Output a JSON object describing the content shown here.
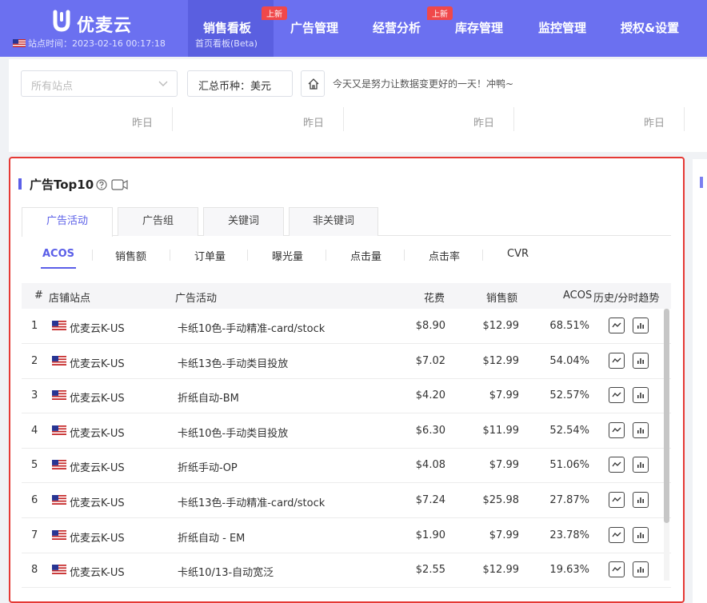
{
  "brand": {
    "name": "优麦云",
    "site_time": "站点时间：2023-02-16 00:17:18"
  },
  "nav": {
    "items": [
      {
        "label": "销售看板",
        "sub": "首页看板(Beta)",
        "badge": "上新",
        "active": true
      },
      {
        "label": "广告管理"
      },
      {
        "label": "经营分析",
        "badge": "上新"
      },
      {
        "label": "库存管理"
      },
      {
        "label": "监控管理"
      },
      {
        "label": "授权&设置"
      }
    ]
  },
  "filter": {
    "site_placeholder": "所有站点",
    "currency_label": "汇总币种：美元",
    "motto": "今天又是努力让数据变更好的一天！冲鸭~",
    "yesterday_label": "昨日"
  },
  "card": {
    "title": "广告Top10",
    "tabs": [
      "广告活动",
      "广告组",
      "关键词",
      "非关键词"
    ],
    "metrics": [
      "ACOS",
      "销售额",
      "订单量",
      "曝光量",
      "点击量",
      "点击率",
      "CVR"
    ]
  },
  "table": {
    "headers": {
      "index": "#",
      "store": "店铺站点",
      "campaign": "广告活动",
      "spend": "花费",
      "sales": "销售额",
      "acos": "ACOS",
      "trend": "历史/分时趋势"
    },
    "rows": [
      {
        "idx": "1",
        "store": "优麦云K-US",
        "campaign": "卡纸10色-手动精准-card/stock",
        "spend": "$8.90",
        "sales": "$12.99",
        "acos": "68.51%"
      },
      {
        "idx": "2",
        "store": "优麦云K-US",
        "campaign": "卡纸13色-手动类目投放",
        "spend": "$7.02",
        "sales": "$12.99",
        "acos": "54.04%"
      },
      {
        "idx": "3",
        "store": "优麦云K-US",
        "campaign": "折纸自动-BM",
        "spend": "$4.20",
        "sales": "$7.99",
        "acos": "52.57%"
      },
      {
        "idx": "4",
        "store": "优麦云K-US",
        "campaign": "卡纸10色-手动类目投放",
        "spend": "$6.30",
        "sales": "$11.99",
        "acos": "52.54%"
      },
      {
        "idx": "5",
        "store": "优麦云K-US",
        "campaign": "折纸手动-OP",
        "spend": "$4.08",
        "sales": "$7.99",
        "acos": "51.06%"
      },
      {
        "idx": "6",
        "store": "优麦云K-US",
        "campaign": "卡纸13色-手动精准-card/stock",
        "spend": "$7.24",
        "sales": "$25.98",
        "acos": "27.87%"
      },
      {
        "idx": "7",
        "store": "优麦云K-US",
        "campaign": "折纸自动 - EM",
        "spend": "$1.90",
        "sales": "$7.99",
        "acos": "23.78%"
      },
      {
        "idx": "8",
        "store": "优麦云K-US",
        "campaign": "卡纸10/13-自动宽泛",
        "spend": "$2.55",
        "sales": "$12.99",
        "acos": "19.63%"
      }
    ]
  },
  "icons": {
    "logo": "u-logo-icon",
    "flag": "us-flag-icon",
    "chevron": "chevron-down-icon",
    "home": "home-icon",
    "help": "help-circle-icon",
    "video": "video-icon",
    "history_trend": "line-chart-icon",
    "hourly_trend": "bar-chart-icon"
  },
  "colors": {
    "nav_bg": "#6b70f0",
    "accent": "#5b5fe8",
    "badge": "#f0484a",
    "highlight_border": "#e53935"
  }
}
